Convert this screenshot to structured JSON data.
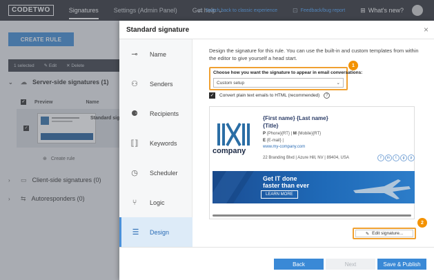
{
  "nav": {
    "logo": "CODETWO",
    "items": [
      "Signatures",
      "Settings (Admin Panel)",
      "Get help"
    ],
    "get_help_caret": "⌄",
    "switch_back": "Switch back to classic experience",
    "feedback": "Feedback/bug report",
    "whats_new": "What's new?"
  },
  "bg": {
    "create_rule": "CREATE RULE",
    "toolbar": {
      "selected": "1 selected",
      "edit": "Edit",
      "delete": "Delete"
    },
    "sections": [
      {
        "label": "Server-side signatures (1)"
      },
      {
        "label": "Client-side signatures (0)"
      },
      {
        "label": "Autoresponders (0)"
      }
    ],
    "table_headers": {
      "preview": "Preview",
      "name": "Name"
    },
    "row_name": "Standard sig",
    "create_rule_link": "Create rule"
  },
  "modal": {
    "title": "Standard signature",
    "close": "×",
    "sidebar": [
      {
        "label": "Name",
        "icon": "name-icon",
        "glyph": "⊸"
      },
      {
        "label": "Senders",
        "icon": "senders-icon",
        "glyph": "⚇"
      },
      {
        "label": "Recipients",
        "icon": "recipients-icon",
        "glyph": "⚈"
      },
      {
        "label": "Keywords",
        "icon": "keywords-icon",
        "glyph": "⟦⟧"
      },
      {
        "label": "Scheduler",
        "icon": "scheduler-icon",
        "glyph": "◷"
      },
      {
        "label": "Logic",
        "icon": "logic-icon",
        "glyph": "⑂"
      },
      {
        "label": "Design",
        "icon": "design-icon",
        "glyph": "☰"
      }
    ],
    "active_item": "Design",
    "description": "Design the signature for this rule. You can use the built-in and custom templates from within the editor to give yourself a head start.",
    "choose_label": "Choose how you want the signature to appear in email conversations:",
    "select_value": "Custom setup",
    "convert_label": "Convert plain text emails to HTML (recommended)",
    "badges": [
      "1",
      "2"
    ],
    "signature": {
      "logo_word": "company",
      "name": "{First name} {Last name}",
      "title": "{Title}",
      "phone_line": {
        "p": "P",
        "phone": "{Phone}{RT}",
        "m": "M",
        "mobile": "{Mobile}{RT}"
      },
      "email_line": {
        "e": "E",
        "email": "{E-mail}"
      },
      "website": "www.my-company.com",
      "address": "22 Branding Blvd | Azure Hill, NV | 89404, USA",
      "socials": [
        "f",
        "in",
        "t",
        "g",
        "p"
      ],
      "banner_line1": "Get IT done",
      "banner_line2": "faster than ever",
      "banner_button": "LEARN MORE"
    },
    "edit_button": "Edit signature...",
    "footer": {
      "back": "Back",
      "next": "Next",
      "publish": "Save & Publish"
    }
  },
  "colors": {
    "accent": "#3a89d6",
    "highlight": "#f0a030",
    "badge": "#f39200",
    "topbar": "#2a2d33"
  }
}
